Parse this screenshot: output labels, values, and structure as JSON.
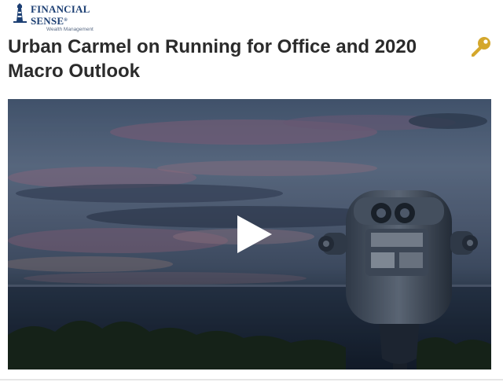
{
  "header": {
    "logo": {
      "brand": "FINANCIAL SENSE",
      "registered": "®",
      "tagline": "Wealth Management"
    },
    "key_icon": "key-icon",
    "colors": {
      "brand": "#1c3f73",
      "key": "#d4a72c"
    }
  },
  "article": {
    "title": "Urban Carmel on Running for Office and 2020 Macro Outlook"
  },
  "video": {
    "play_icon": "play-icon",
    "scene": "sunset-sky-ocean-coin-binoculars"
  }
}
